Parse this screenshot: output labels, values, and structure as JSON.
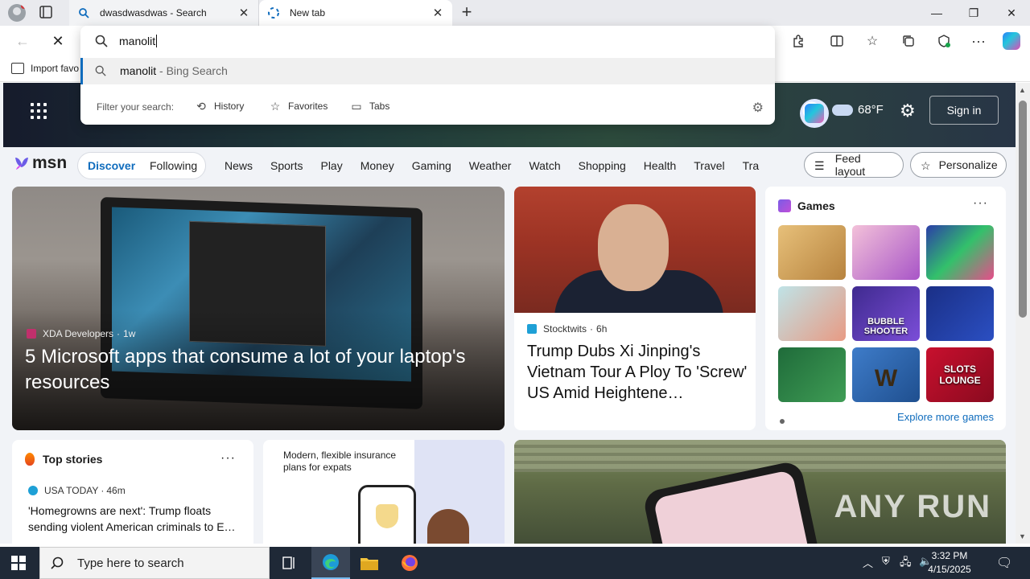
{
  "browser": {
    "tabs": [
      {
        "label": "dwasdwasdwas - Search",
        "close": "✕"
      },
      {
        "label": "New tab",
        "close": "✕"
      }
    ],
    "new_tab": "+",
    "window_controls": {
      "minimize": "—",
      "restore": "❐",
      "close": "✕"
    },
    "address_value": "manolit",
    "favorites_bar": {
      "import_label": "Import favo"
    }
  },
  "omnibox": {
    "suggestion": {
      "query": "manolit",
      "suffix": " - Bing Search"
    },
    "filter_label": "Filter your search:",
    "filters": [
      {
        "label": "History",
        "icon": "history-icon"
      },
      {
        "label": "Favorites",
        "icon": "star-icon"
      },
      {
        "label": "Tabs",
        "icon": "tabs-icon"
      }
    ]
  },
  "msn": {
    "weather": {
      "temp": "68°F"
    },
    "sign_in": "Sign in",
    "logo": "msn",
    "feed_tabs": {
      "discover": "Discover",
      "following": "Following"
    },
    "nav_links": [
      "News",
      "Sports",
      "Play",
      "Money",
      "Gaming",
      "Weather",
      "Watch",
      "Shopping",
      "Health",
      "Travel",
      "Tra"
    ],
    "feed_layout": "Feed layout",
    "personalize": "Personalize",
    "hero_card": {
      "source": "XDA Developers",
      "age": "1w",
      "headline": "5 Microsoft apps that consume a lot of your laptop's resources"
    },
    "news_card": {
      "source": "Stocktwits",
      "age": "6h",
      "headline": "Trump Dubs Xi Jinping's Vietnam Tour A Ploy To 'Screw' US Amid Heightene…"
    },
    "games": {
      "title": "Games",
      "more": "···",
      "tiles": [
        "",
        "",
        "",
        "",
        "BUBBLE SHOOTER",
        "",
        "",
        "W",
        "SLOTS LOUNGE"
      ],
      "explore": "Explore more games"
    },
    "top_stories": {
      "title": "Top stories",
      "more": "···",
      "source": "USA TODAY",
      "age": "46m",
      "headline": "'Homegrowns are next': Trump floats sending violent American criminals to E…"
    },
    "ad": {
      "text": "Modern, flexible insurance plans for expats"
    },
    "watermark": "ANY RUN"
  },
  "taskbar": {
    "search_placeholder": "Type here to search",
    "time": "3:32 PM",
    "date": "4/15/2025"
  },
  "colors": {
    "accent": "#0f6cbd",
    "taskbar": "#1f2937"
  }
}
